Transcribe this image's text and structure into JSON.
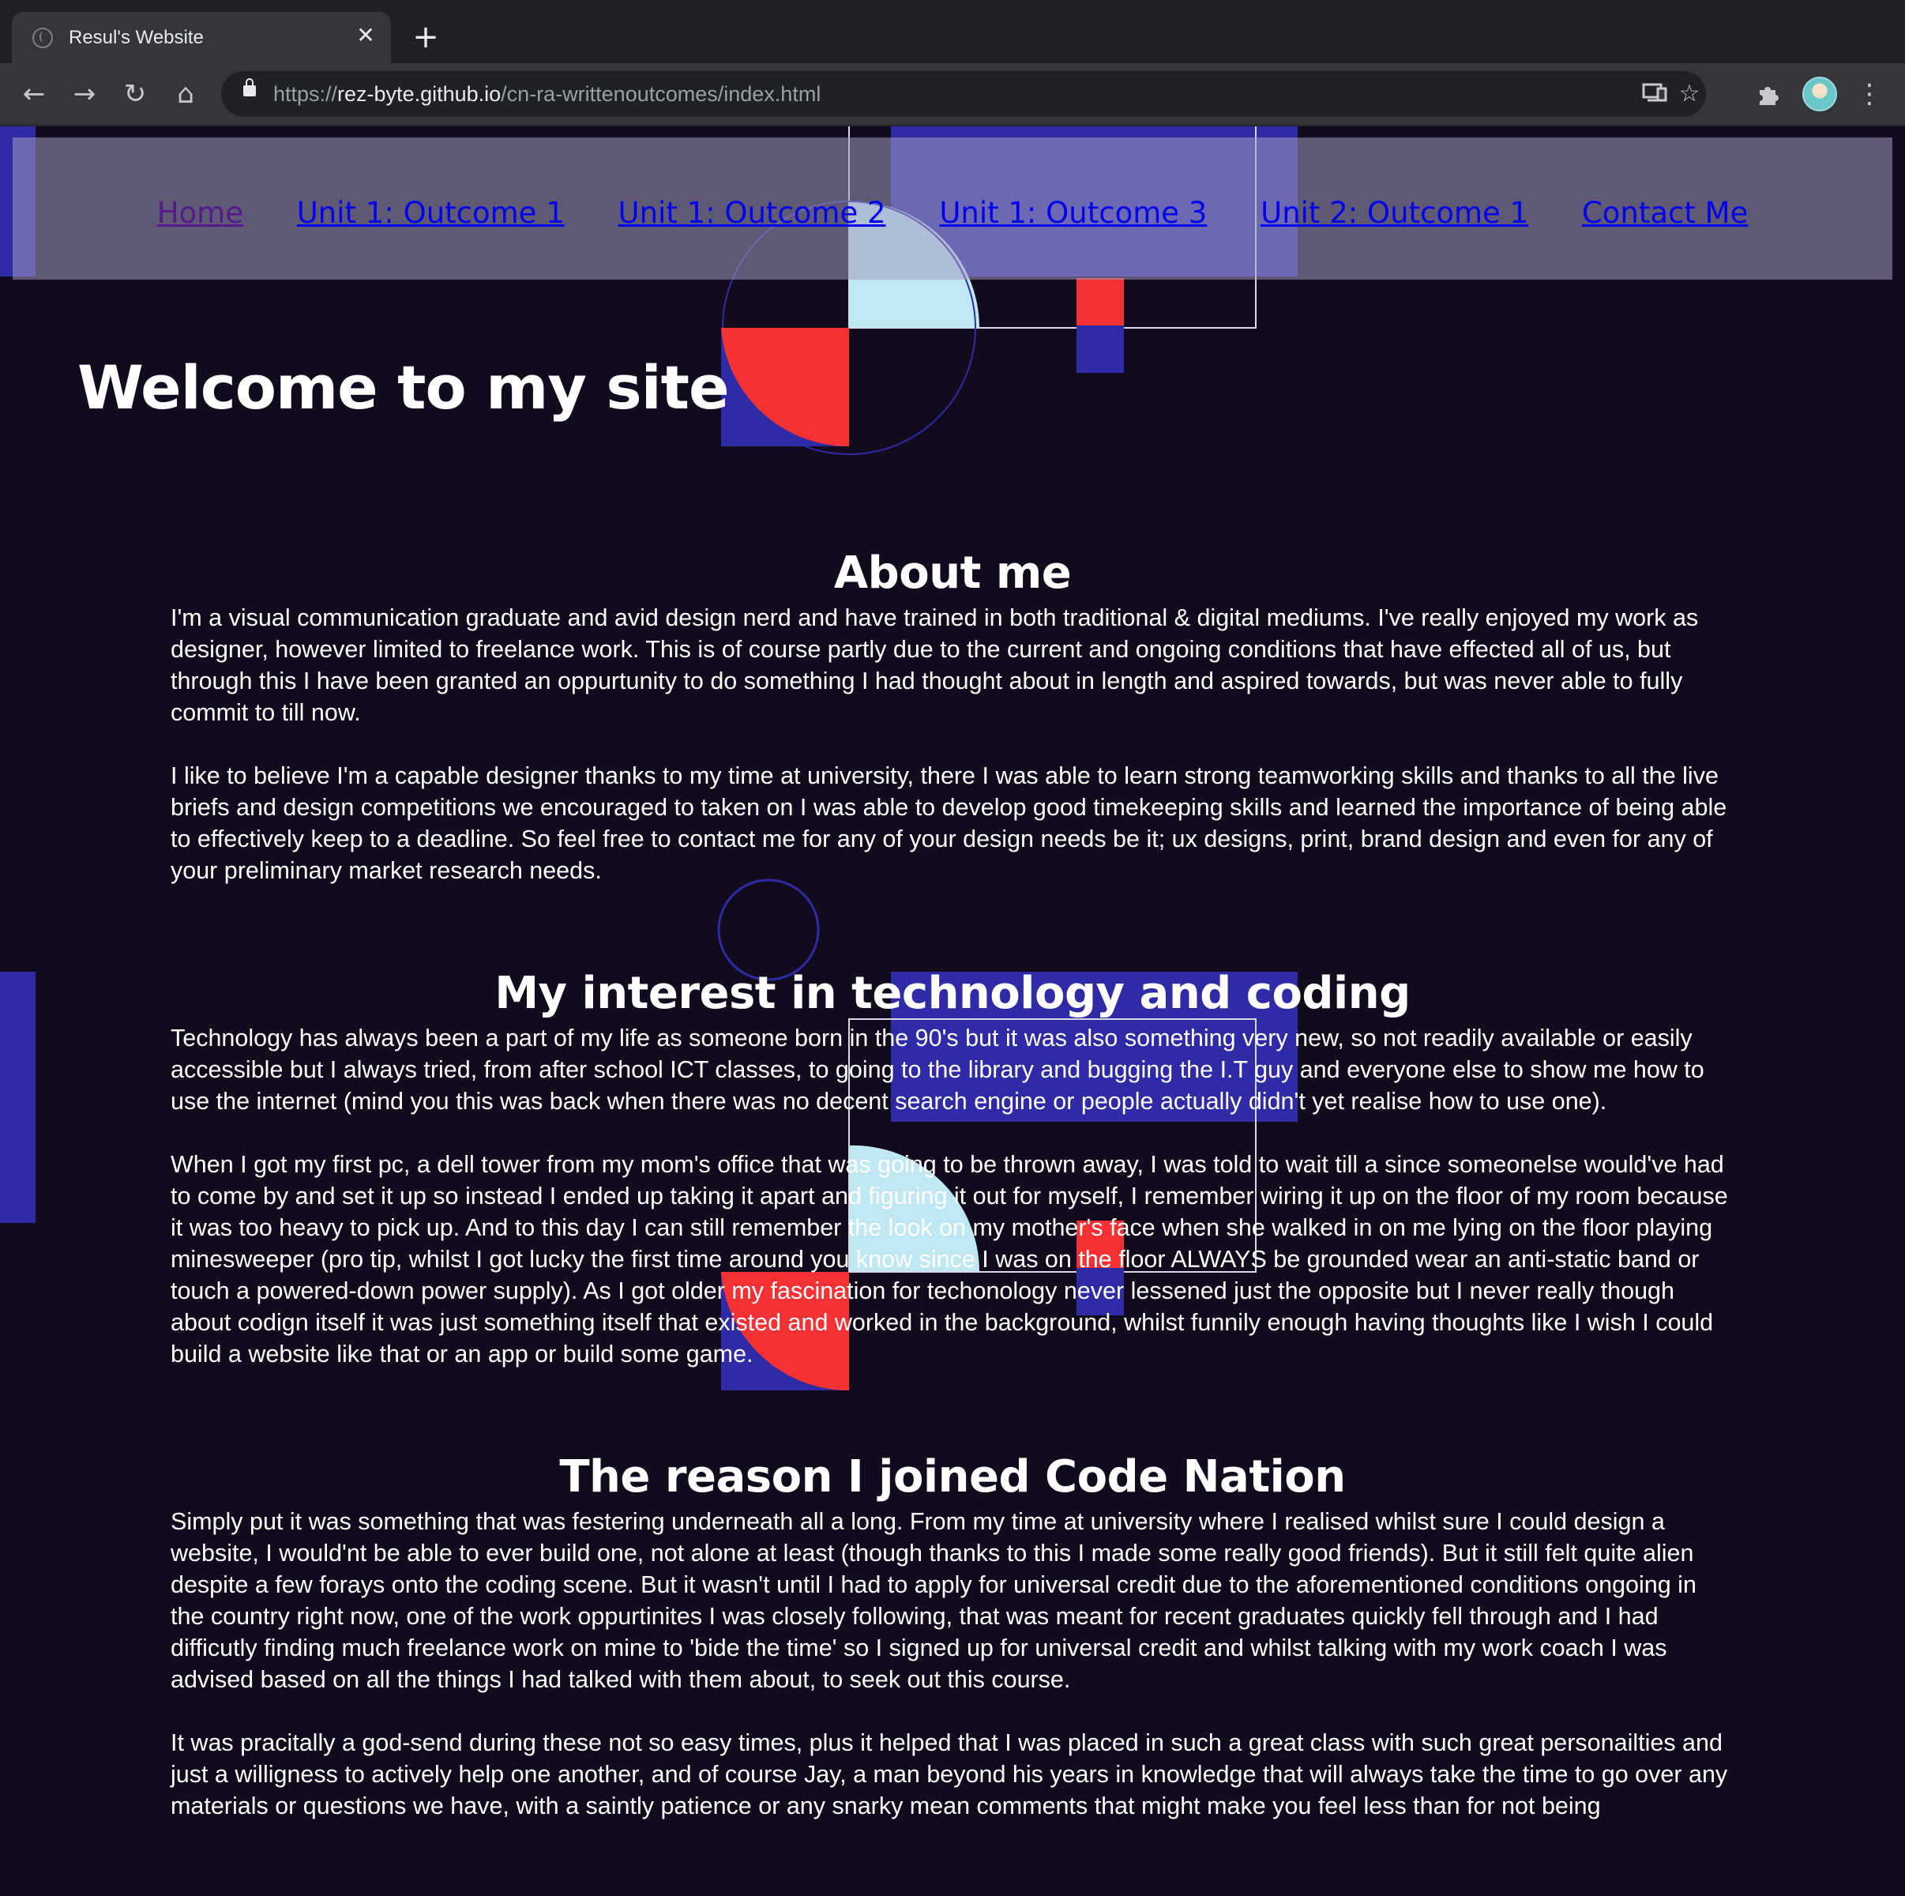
{
  "browser": {
    "tab_title": "Resul's Website",
    "tab_close_icon": "close-icon",
    "new_tab_icon": "plus-icon",
    "nav_icons": [
      "back-icon",
      "forward-icon",
      "reload-icon",
      "home-icon"
    ],
    "url_scheme": "https://",
    "url_host": "rez-byte.github.io",
    "url_path": "/cn-ra-writtenoutcomes/index.html",
    "omnibox_icons": [
      "cast-icon",
      "star-icon"
    ],
    "toolbar_icons": [
      "extensions-icon",
      "avatar",
      "menu-icon"
    ]
  },
  "nav": {
    "links": [
      "Home",
      "Unit 1: Outcome 1",
      "Unit 1: Outcome 2",
      "Unit 1: Outcome 3",
      "Unit 2: Outcome 1",
      "Contact Me"
    ]
  },
  "hero": {
    "title": "Welcome to my site"
  },
  "sections": [
    {
      "title": "About me",
      "paragraphs": [
        "I'm a visual communication graduate and avid design nerd and have trained in both traditional & digital mediums. I've really enjoyed my work as designer, however limited to freelance work. This is of course partly due to the current and ongoing conditions that have effected all of us, but through this I have been granted an oppurtunity to do something I had thought about in length and aspired towards, but was never able to fully commit to till now.",
        "I like to believe I'm a capable designer thanks to my time at university, there I was able to learn strong teamworking skills and thanks to all the live briefs and design competitions we encouraged to taken on I was able to develop good timekeeping skills and learned the importance of being able to effectively keep to a deadline. So feel free to contact me for any of your design needs be it; ux designs, print, brand design and even for any of your preliminary market research needs."
      ]
    },
    {
      "title": "My interest in technology and coding",
      "paragraphs": [
        "Technology has always been a part of my life as someone born in the 90's but it was also something very new, so not readily available or easily accessible but I always tried, from after school ICT classes, to going to the library and bugging the I.T guy and everyone else to show me how to use the internet (mind you this was back when there was no decent search engine or people actually didn't yet realise how to use one).",
        "When I got my first pc, a dell tower from my mom's office that was going to be thrown away, I was told to wait till a since someonelse would've had to come by and set it up so instead I ended up taking it apart and figuring it out for myself, I remember wiring it up on the floor of my room because it was too heavy to pick up. And to this day I can still remember the look on my mother's face when she walked in on me lying on the floor playing minesweeper (pro tip, whilst I got lucky the first time around you know since I was on the floor ALWAYS be grounded wear an anti-static band or touch a powered-down power supply). As I got older my fascination for techonology never lessened just the opposite but I never really though about codign itself it was just something itself that existed and worked in the background, whilst funnily enough having thoughts like I wish I could build a website like that or an app or build some game."
      ]
    },
    {
      "title": "The reason I joined Code Nation",
      "paragraphs": [
        "Simply put it was something that was festering underneath all a long. From my time at university where I realised whilst sure I could design a website, I would'nt be able to ever build one, not alone at least (though thanks to this I made some really good friends). But it still felt quite alien despite a few forays onto the coding scene. But it wasn't until I had to apply for universal credit due to the aforementioned conditions ongoing in the country right now, one of the work oppurtinites I was closely following, that was meant for recent graduates quickly fell through and I had difficutly finding much freelance work on mine to 'bide the time' so I signed up for universal credit and whilst talking with my work coach I was advised based on all the things I had talked with them about, to seek out this course.",
        "It was pracitally a god-send during these not so easy times, plus it helped that I was placed in such a great class with such great personailties and just a willigness to actively help one another, and of course Jay, a man beyond his years in knowledge that will always take the time to go over any materials or questions we have, with a saintly patience or any snarky mean comments that might make you feel less than for not being"
      ]
    }
  ],
  "colors": {
    "background": "#110b1d",
    "deco_blue": "#2f2aa6",
    "deco_red": "#f53134",
    "deco_light": "#bfe8f2",
    "nav_overlay": "rgba(160,155,190,0.55)",
    "link": "#0000ee",
    "visited_link": "#551a8b"
  }
}
